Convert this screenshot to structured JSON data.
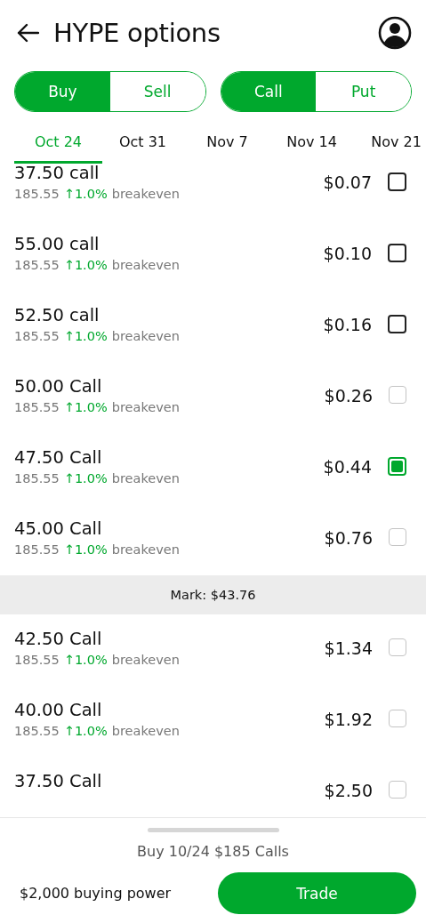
{
  "header": {
    "title": "HYPE options"
  },
  "side_toggle": [
    {
      "label": "Buy",
      "selected": true
    },
    {
      "label": "Sell",
      "selected": false
    }
  ],
  "type_toggle": [
    {
      "label": "Call",
      "selected": true
    },
    {
      "label": "Put",
      "selected": false
    }
  ],
  "date_tabs": [
    {
      "label": "Oct 24",
      "selected": true
    },
    {
      "label": "Oct 31",
      "selected": false
    },
    {
      "label": "Nov 7",
      "selected": false
    },
    {
      "label": "Nov 14",
      "selected": false
    },
    {
      "label": "Nov 21",
      "selected": false
    }
  ],
  "contracts": [
    {
      "kind": "option",
      "title": "37.50 call",
      "breakeven": "185.55",
      "change": "↑1.0%",
      "breakeven_label": "breakeven",
      "price": "$0.07",
      "checked": false,
      "disabled": false
    },
    {
      "kind": "option",
      "title": "55.00 call",
      "breakeven": "185.55",
      "change": "↑1.0%",
      "breakeven_label": "breakeven",
      "price": "$0.10",
      "checked": false,
      "disabled": false
    },
    {
      "kind": "option",
      "title": "52.50 call",
      "breakeven": "185.55",
      "change": "↑1.0%",
      "breakeven_label": "breakeven",
      "price": "$0.16",
      "checked": false,
      "disabled": false
    },
    {
      "kind": "option",
      "title": "50.00 Call",
      "breakeven": "185.55",
      "change": "↑1.0%",
      "breakeven_label": "breakeven",
      "price": "$0.26",
      "checked": false,
      "disabled": true
    },
    {
      "kind": "option",
      "title": "47.50 Call",
      "breakeven": "185.55",
      "change": "↑1.0%",
      "breakeven_label": "breakeven",
      "price": "$0.44",
      "checked": true,
      "disabled": false
    },
    {
      "kind": "option",
      "title": "45.00 Call",
      "breakeven": "185.55",
      "change": "↑1.0%",
      "breakeven_label": "breakeven",
      "price": "$0.76",
      "checked": false,
      "disabled": true
    },
    {
      "kind": "mark",
      "label": "Mark: $43.76"
    },
    {
      "kind": "option",
      "title": "42.50 Call",
      "breakeven": "185.55",
      "change": "↑1.0%",
      "breakeven_label": "breakeven",
      "price": "$1.34",
      "checked": false,
      "disabled": true
    },
    {
      "kind": "option",
      "title": "40.00 Call",
      "breakeven": "185.55",
      "change": "↑1.0%",
      "breakeven_label": "breakeven",
      "price": "$1.92",
      "checked": false,
      "disabled": true
    },
    {
      "kind": "option",
      "title": "37.50 Call",
      "price": "$2.50",
      "checked": false,
      "disabled": true
    }
  ],
  "footer": {
    "summary": "Buy 10/24 $185 Calls",
    "buying_power": "$2,000 buying power",
    "trade_button": "Trade"
  }
}
